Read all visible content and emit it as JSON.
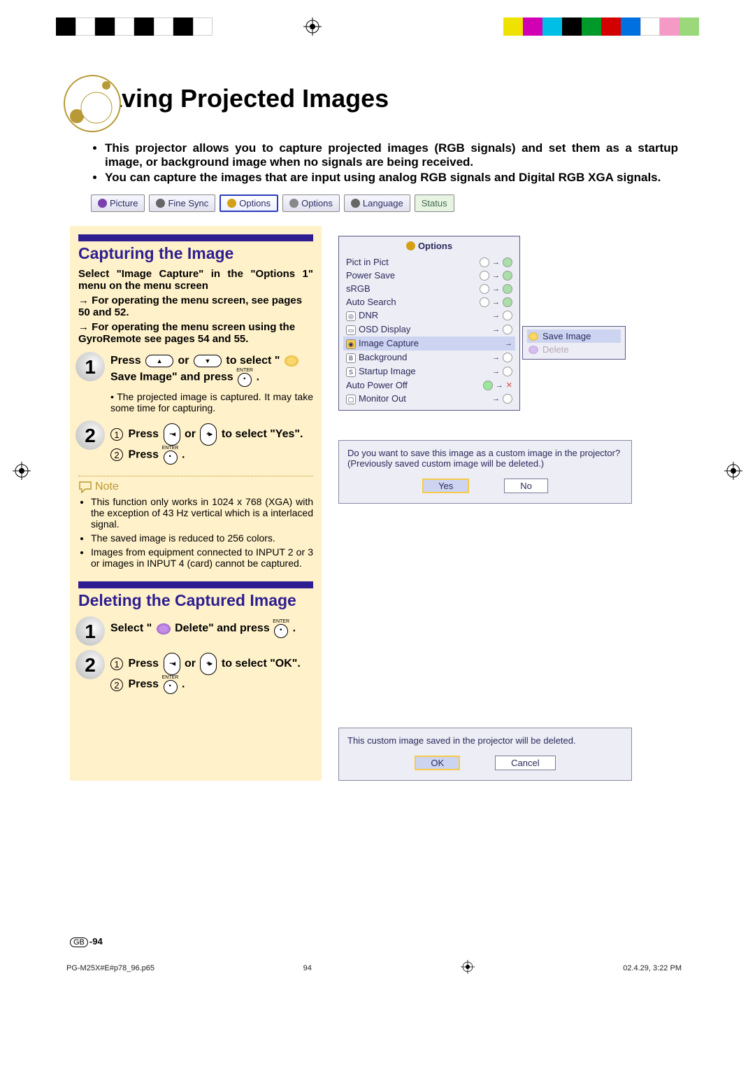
{
  "crop_colors": {
    "bw": [
      "#000000",
      "#ffffff",
      "#000000",
      "#ffffff",
      "#000000",
      "#ffffff",
      "#000000",
      "#ffffff"
    ],
    "color": [
      "#f0e200",
      "#d200b5",
      "#00bfe6",
      "#000000",
      "#009a2a",
      "#d40000",
      "#006fe0",
      "#ffffff",
      "#f59ac6",
      "#9ad87b"
    ]
  },
  "title": "Saving Projected Images",
  "intro": {
    "b1": "This projector allows you to capture projected images (RGB signals) and set them as a startup image, or background image when no signals are being received.",
    "b2": "You can capture the images that are input using analog RGB signals and Digital RGB XGA signals."
  },
  "tabs": {
    "picture": "Picture",
    "finesync": "Fine Sync",
    "options1": "Options",
    "options2": "Options",
    "language": "Language",
    "status": "Status"
  },
  "section1": {
    "title": "Capturing the Image",
    "lead": "Select \"Image Capture\" in the \"Options 1\" menu on the menu screen",
    "sub1": "For operating the menu screen, see pages 50 and 52.",
    "sub2": "For operating the menu screen using the GyroRemote see pages 54 and 55."
  },
  "step1": {
    "pre": "Press ",
    "mid": " or ",
    "post_a": " to select \"",
    "post_b": " Save Image\" and press ",
    "dot": ".",
    "sub": "The projected image is captured. It may take some time for capturing."
  },
  "step2": {
    "p1_pre": "Press ",
    "p1_mid": " or ",
    "p1_post": " to select \"Yes\".",
    "p2_pre": "Press ",
    "p2_post": "."
  },
  "note": {
    "head": "Note",
    "n1": "This function only works in 1024 x 768 (XGA) with the exception of 43 Hz vertical which is a interlaced signal.",
    "n2": "The saved image is reduced to 256 colors.",
    "n3": "Images from equipment connected to INPUT 2 or 3 or images in INPUT 4 (card) cannot be captured."
  },
  "section2": {
    "title": "Deleting the Captured Image"
  },
  "del_step1": {
    "pre": "Select \"",
    "mid": " Delete\" and press ",
    "post": "."
  },
  "del_step2": {
    "p1_pre": "Press ",
    "p1_mid": " or ",
    "p1_post": " to select \"OK\".",
    "p2_pre": "Press ",
    "p2_post": "."
  },
  "options_panel": {
    "header": "Options",
    "rows": {
      "pict": "Pict in Pict",
      "power": "Power Save",
      "srgb": "sRGB",
      "auto": "Auto Search",
      "dnr": "DNR",
      "osd": "OSD Display",
      "imgcap": "Image Capture",
      "bg": "Background",
      "startup": "Startup Image",
      "autopow": "Auto Power Off",
      "monitor": "Monitor Out"
    }
  },
  "side_popup": {
    "save": "Save Image",
    "delete": "Delete"
  },
  "confirm1": {
    "l1": "Do you want to save this image as a custom image in the projector?",
    "l2": "(Previously saved custom image will be deleted.)",
    "yes": "Yes",
    "no": "No"
  },
  "confirm2": {
    "l1": "This custom image saved in the projector will be deleted.",
    "ok": "OK",
    "cancel": "Cancel"
  },
  "page_num": {
    "region": "GB",
    "num": "-94"
  },
  "footer": {
    "file": "PG-M25X#E#p78_96.p65",
    "page": "94",
    "timestamp": "02.4.29, 3:22 PM"
  }
}
